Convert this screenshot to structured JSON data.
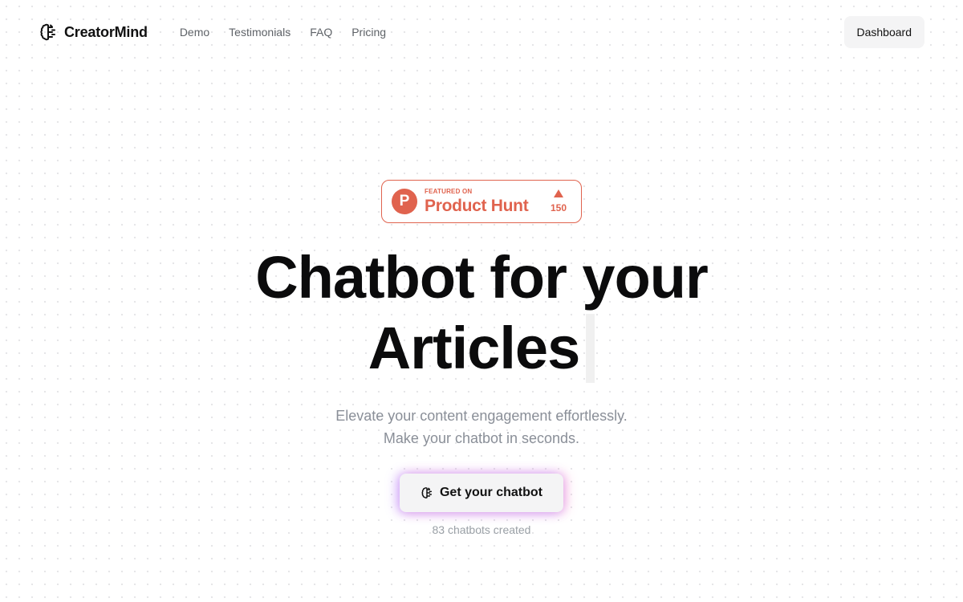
{
  "header": {
    "brand_name": "CreatorMind",
    "brand_icon": "brain-icon",
    "nav": [
      {
        "label": "Demo"
      },
      {
        "label": "Testimonials"
      },
      {
        "label": "FAQ"
      },
      {
        "label": "Pricing"
      }
    ],
    "dashboard_label": "Dashboard"
  },
  "badge": {
    "small_text": "FEATURED ON",
    "big_text": "Product Hunt",
    "logo_letter": "P",
    "votes": "150",
    "color": "#e0634e"
  },
  "hero": {
    "headline_line1": "Chatbot for your",
    "headline_line2": "Articles",
    "subtitle_line1": "Elevate your content engagement effortlessly.",
    "subtitle_line2": "Make your chatbot in seconds.",
    "cta_label": "Get your chatbot",
    "cta_icon": "brain-icon",
    "count_text": "83 chatbots created"
  }
}
